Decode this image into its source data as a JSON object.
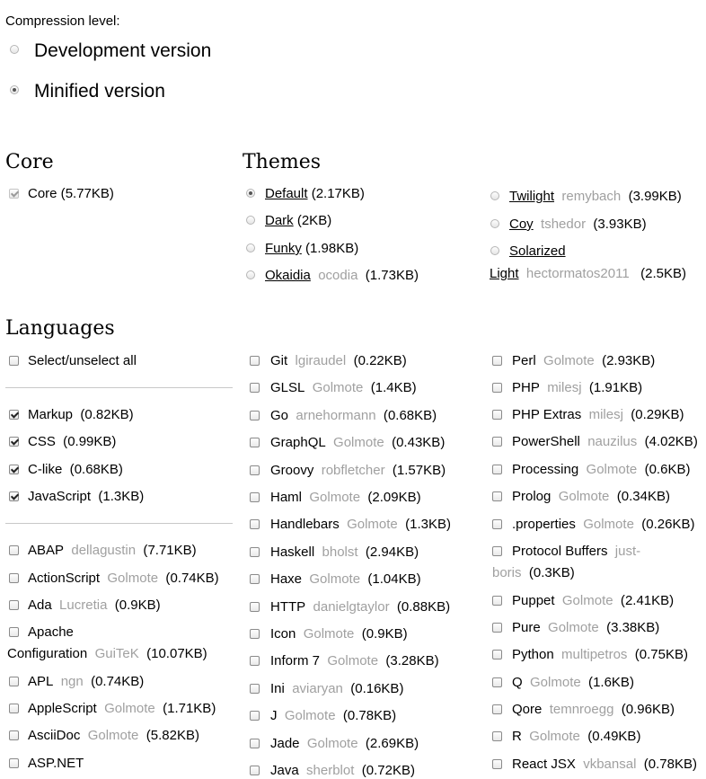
{
  "compression": {
    "label": "Compression level:",
    "options": [
      {
        "label": "Development version",
        "selected": false
      },
      {
        "label": "Minified version",
        "selected": true
      }
    ]
  },
  "core": {
    "title": "Core",
    "item": {
      "name": "Core",
      "size": "5.77KB",
      "checked": true
    }
  },
  "themes": {
    "title": "Themes",
    "items": [
      {
        "name": "Default",
        "owner": "",
        "size": "2.17KB",
        "selected": true
      },
      {
        "name": "Dark",
        "owner": "",
        "size": "2KB",
        "selected": false
      },
      {
        "name": "Funky",
        "owner": "",
        "size": "1.98KB",
        "selected": false
      },
      {
        "name": "Okaidia",
        "owner": "ocodia",
        "size": "1.73KB",
        "selected": false
      },
      {
        "name": "Twilight",
        "owner": "remybach",
        "size": "3.99KB",
        "selected": false
      },
      {
        "name": "Coy",
        "owner": "tshedor",
        "size": "3.93KB",
        "selected": false
      },
      {
        "name": "Solarized",
        "name2": "Light",
        "owner": "hectormatos2011",
        "size": "2.5KB",
        "selected": false
      }
    ]
  },
  "languages": {
    "title": "Languages",
    "select_all": "Select/unselect all",
    "col1": [
      {
        "name": "Markup",
        "owner": "",
        "size": "0.82KB",
        "checked": true
      },
      {
        "name": "CSS",
        "owner": "",
        "size": "0.99KB",
        "checked": true
      },
      {
        "name": "C-like",
        "owner": "",
        "size": "0.68KB",
        "checked": true
      },
      {
        "name": "JavaScript",
        "owner": "",
        "size": "1.3KB",
        "checked": true
      },
      {
        "name": "ABAP",
        "owner": "dellagustin",
        "size": "7.71KB",
        "checked": false
      },
      {
        "name": "ActionScript",
        "owner": "Golmote",
        "size": "0.74KB",
        "checked": false
      },
      {
        "name": "Ada",
        "owner": "Lucretia",
        "size": "0.9KB",
        "checked": false
      },
      {
        "name": "Apache",
        "name2": "Configuration",
        "owner": "GuiTeK",
        "size": "10.07KB",
        "checked": false
      },
      {
        "name": "APL",
        "owner": "ngn",
        "size": "0.74KB",
        "checked": false
      },
      {
        "name": "AppleScript",
        "owner": "Golmote",
        "size": "1.71KB",
        "checked": false
      },
      {
        "name": "AsciiDoc",
        "owner": "Golmote",
        "size": "5.82KB",
        "checked": false
      },
      {
        "name": "ASP.NET",
        "owner": "",
        "size": "",
        "checked": false
      }
    ],
    "col2": [
      {
        "name": "Git",
        "owner": "lgiraudel",
        "size": "0.22KB"
      },
      {
        "name": "GLSL",
        "owner": "Golmote",
        "size": "1.4KB"
      },
      {
        "name": "Go",
        "owner": "arnehormann",
        "size": "0.68KB"
      },
      {
        "name": "GraphQL",
        "owner": "Golmote",
        "size": "0.43KB"
      },
      {
        "name": "Groovy",
        "owner": "robfletcher",
        "size": "1.57KB"
      },
      {
        "name": "Haml",
        "owner": "Golmote",
        "size": "2.09KB"
      },
      {
        "name": "Handlebars",
        "owner": "Golmote",
        "size": "1.3KB"
      },
      {
        "name": "Haskell",
        "owner": "bholst",
        "size": "2.94KB"
      },
      {
        "name": "Haxe",
        "owner": "Golmote",
        "size": "1.04KB"
      },
      {
        "name": "HTTP",
        "owner": "danielgtaylor",
        "size": "0.88KB"
      },
      {
        "name": "Icon",
        "owner": "Golmote",
        "size": "0.9KB"
      },
      {
        "name": "Inform 7",
        "owner": "Golmote",
        "size": "3.28KB"
      },
      {
        "name": "Ini",
        "owner": "aviaryan",
        "size": "0.16KB"
      },
      {
        "name": "J",
        "owner": "Golmote",
        "size": "0.78KB"
      },
      {
        "name": "Jade",
        "owner": "Golmote",
        "size": "2.69KB"
      },
      {
        "name": "Java",
        "owner": "sherblot",
        "size": "0.72KB"
      }
    ],
    "col3": [
      {
        "name": "Perl",
        "owner": "Golmote",
        "size": "2.93KB"
      },
      {
        "name": "PHP",
        "owner": "milesj",
        "size": "1.91KB"
      },
      {
        "name": "PHP Extras",
        "owner": "milesj",
        "size": "0.29KB"
      },
      {
        "name": "PowerShell",
        "owner": "nauzilus",
        "size": "4.02KB"
      },
      {
        "name": "Processing",
        "owner": "Golmote",
        "size": "0.6KB"
      },
      {
        "name": "Prolog",
        "owner": "Golmote",
        "size": "0.34KB"
      },
      {
        "name": ".properties",
        "owner": "Golmote",
        "size": "0.26KB"
      },
      {
        "name": "Protocol Buffers",
        "owner": "just-",
        "owner2": "boris",
        "size": "0.3KB"
      },
      {
        "name": "Puppet",
        "owner": "Golmote",
        "size": "2.41KB"
      },
      {
        "name": "Pure",
        "owner": "Golmote",
        "size": "3.38KB"
      },
      {
        "name": "Python",
        "owner": "multipetros",
        "size": "0.75KB"
      },
      {
        "name": "Q",
        "owner": "Golmote",
        "size": "1.6KB"
      },
      {
        "name": "Qore",
        "owner": "temnroegg",
        "size": "0.96KB"
      },
      {
        "name": "R",
        "owner": "Golmote",
        "size": "0.49KB"
      },
      {
        "name": "React JSX",
        "owner": "vkbansal",
        "size": "0.78KB"
      }
    ]
  }
}
